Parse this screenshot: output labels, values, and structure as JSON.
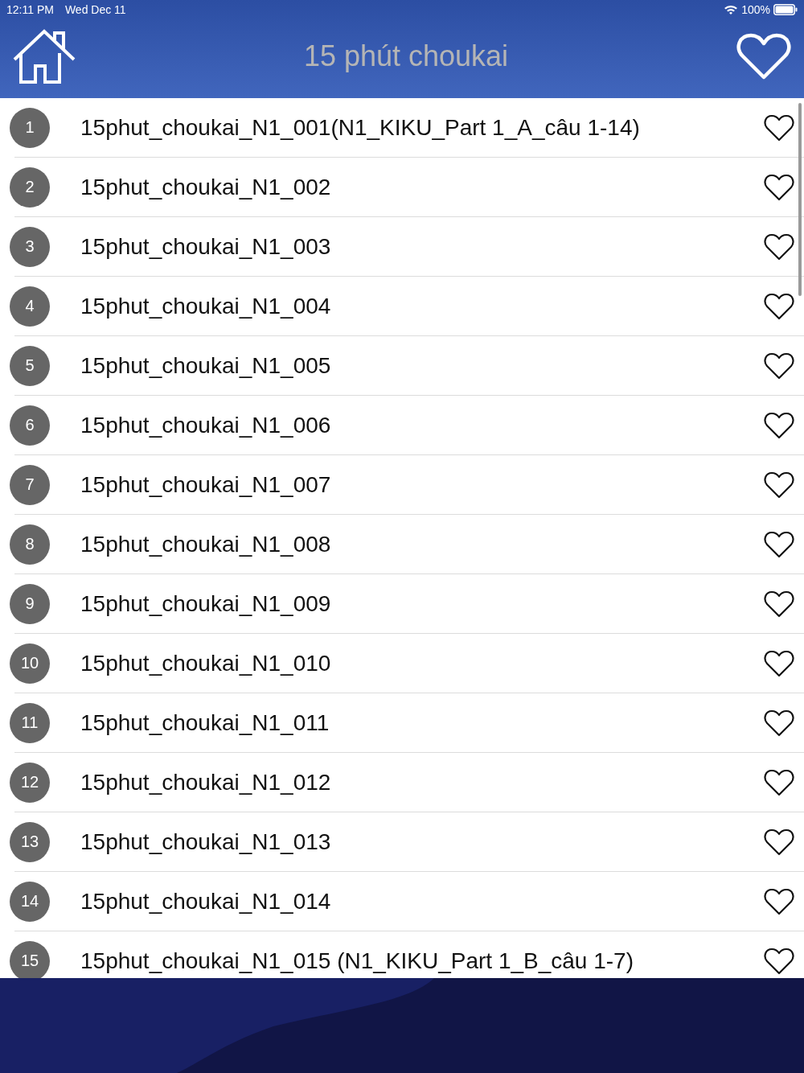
{
  "status_bar": {
    "time": "12:11 PM",
    "date": "Wed Dec 11",
    "battery": "100%"
  },
  "nav_bar": {
    "title": "15 phút choukai"
  },
  "lessons": [
    {
      "number": "1",
      "title": "15phut_choukai_N1_001(N1_KIKU_Part 1_A_câu 1-14)",
      "favorite": false
    },
    {
      "number": "2",
      "title": "15phut_choukai_N1_002",
      "favorite": false
    },
    {
      "number": "3",
      "title": "15phut_choukai_N1_003",
      "favorite": false
    },
    {
      "number": "4",
      "title": "15phut_choukai_N1_004",
      "favorite": false
    },
    {
      "number": "5",
      "title": "15phut_choukai_N1_005",
      "favorite": false
    },
    {
      "number": "6",
      "title": "15phut_choukai_N1_006",
      "favorite": false
    },
    {
      "number": "7",
      "title": "15phut_choukai_N1_007",
      "favorite": false
    },
    {
      "number": "8",
      "title": "15phut_choukai_N1_008",
      "favorite": false
    },
    {
      "number": "9",
      "title": "15phut_choukai_N1_009",
      "favorite": false
    },
    {
      "number": "10",
      "title": "15phut_choukai_N1_010",
      "favorite": false
    },
    {
      "number": "11",
      "title": "15phut_choukai_N1_011",
      "favorite": false
    },
    {
      "number": "12",
      "title": "15phut_choukai_N1_012",
      "favorite": false
    },
    {
      "number": "13",
      "title": "15phut_choukai_N1_013",
      "favorite": false
    },
    {
      "number": "14",
      "title": "15phut_choukai_N1_014",
      "favorite": false
    },
    {
      "number": "15",
      "title": "15phut_choukai_N1_015 (N1_KIKU_Part 1_B_câu 1-7)",
      "favorite": false
    }
  ]
}
